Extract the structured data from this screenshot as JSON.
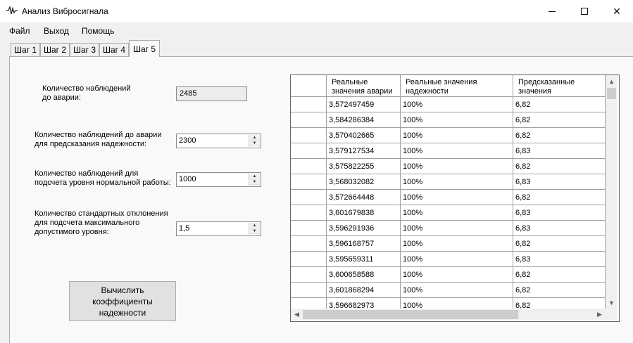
{
  "window": {
    "title": "Анализ Вибросигнала",
    "icon": "signal-wave-icon",
    "min_glyph": "",
    "close_glyph": "✕"
  },
  "menu": [
    "Файл",
    "Выход",
    "Помощь"
  ],
  "tabs": [
    "Шаг 1",
    "Шаг 2",
    "Шаг 3",
    "Шаг 4",
    "Шаг 5"
  ],
  "active_tab": "Шаг 5",
  "form": {
    "obs_label_1": "Количество наблюдений",
    "obs_label_2": "до аварии:",
    "obs_value": "2485",
    "pred_label_1": "Количество наблюдений до аварии",
    "pred_label_2": "для предсказания надежности:",
    "pred_value": "2300",
    "norm_label_1": "Количество наблюдений для",
    "norm_label_2": "подсчета уровня нормальной работы:",
    "norm_value": "1000",
    "std_label_1": "Количество стандартных отклонения",
    "std_label_2": "для подсчета максимального",
    "std_label_3": "допустимого уровня:",
    "std_value": "1,5",
    "calc_line_1": "Вычислить",
    "calc_line_2": "коэффициенты",
    "calc_line_3": "надежности"
  },
  "grid": {
    "columns": [
      "",
      "Реальные значения аварии",
      "Реальные значения надежности",
      "Предсказанные значения"
    ],
    "rows": [
      [
        "3,572497459",
        "100%",
        "6,82"
      ],
      [
        "3,584286384",
        "100%",
        "6,82"
      ],
      [
        "3,570402665",
        "100%",
        "6,82"
      ],
      [
        "3,579127534",
        "100%",
        "6,83"
      ],
      [
        "3,575822255",
        "100%",
        "6,82"
      ],
      [
        "3,568032082",
        "100%",
        "6,83"
      ],
      [
        "3,572664448",
        "100%",
        "6,82"
      ],
      [
        "3,601679838",
        "100%",
        "6,83"
      ],
      [
        "3,596291936",
        "100%",
        "6,83"
      ],
      [
        "3,596168757",
        "100%",
        "6,82"
      ],
      [
        "3,595659311",
        "100%",
        "6,83"
      ],
      [
        "3,600658588",
        "100%",
        "6,82"
      ],
      [
        "3,601868294",
        "100%",
        "6,82"
      ],
      [
        "3,596682973",
        "100%",
        "6,82"
      ]
    ]
  }
}
